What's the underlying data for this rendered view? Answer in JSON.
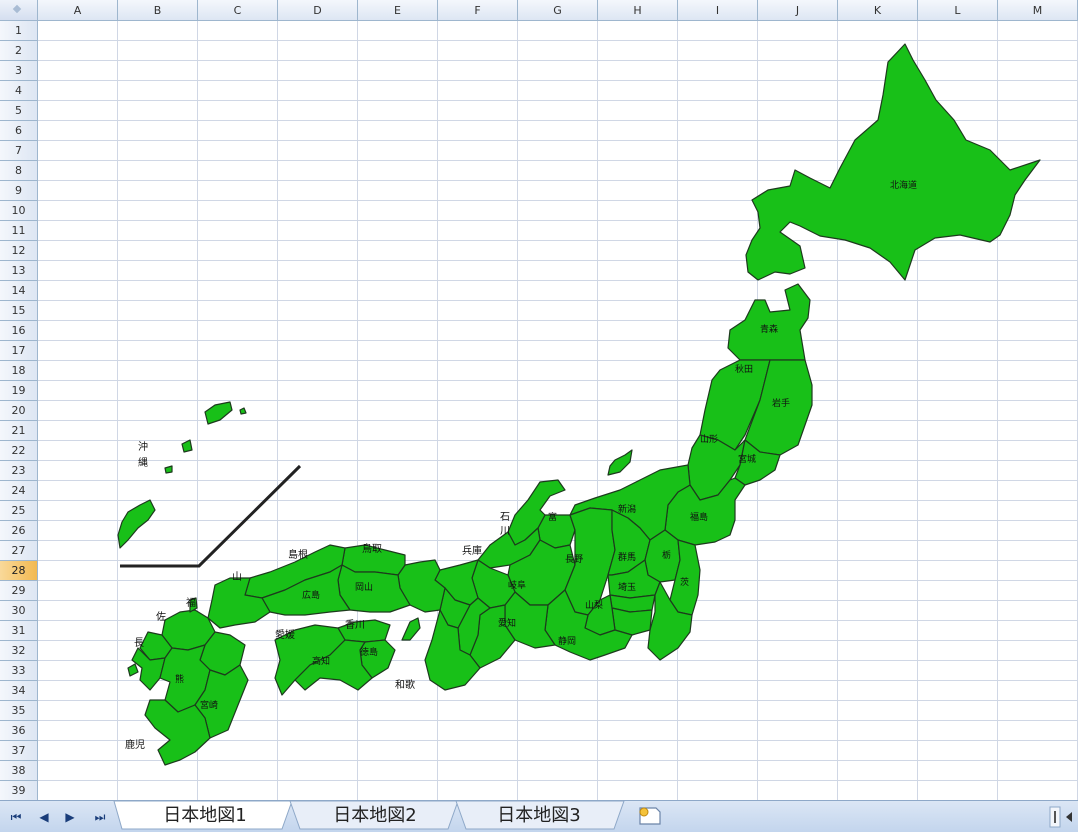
{
  "sheet": {
    "columns": [
      "A",
      "B",
      "C",
      "D",
      "E",
      "F",
      "G",
      "H",
      "I",
      "J",
      "K",
      "L",
      "M"
    ],
    "rows": [
      "1",
      "2",
      "3",
      "4",
      "5",
      "6",
      "7",
      "8",
      "9",
      "10",
      "11",
      "12",
      "13",
      "14",
      "15",
      "16",
      "17",
      "18",
      "19",
      "20",
      "21",
      "22",
      "23",
      "24",
      "25",
      "26",
      "27",
      "28",
      "29",
      "30",
      "31",
      "32",
      "33",
      "34",
      "35",
      "36",
      "37",
      "38",
      "39"
    ],
    "active_row": "28"
  },
  "map": {
    "labels": {
      "hokkaido": "北海道",
      "aomori": "青森",
      "akita": "秋田",
      "iwate": "岩手",
      "yamagata": "山形",
      "miyagi": "宮城",
      "fukushima": "福島",
      "niigata": "新潟",
      "ishikawa_1": "石",
      "ishikawa_2": "川",
      "toyama": "富",
      "tottori": "鳥取",
      "shimane": "島根",
      "hyogo": "兵庫",
      "yamaguchi": "山",
      "hiroshima": "広島",
      "okayama": "岡山",
      "gifu": "岐阜",
      "nagano": "長野",
      "gunma": "群馬",
      "tochigi": "栃",
      "ibaraki": "茨",
      "saitama": "埼玉",
      "yamanashi": "山梨",
      "shizuoka": "静岡",
      "aichi": "愛知",
      "ehime": "愛媛",
      "kagawa": "香川",
      "kochi": "高知",
      "tokushima": "徳島",
      "wakayama": "和歌",
      "fukuoka": "福",
      "saga": "佐",
      "nagasaki": "長",
      "kumamoto": "熊",
      "miyazaki": "宮崎",
      "kagoshima": "鹿児",
      "okinawa_1": "沖",
      "okinawa_2": "縄"
    }
  },
  "tabbar": {
    "nav": {
      "first": "⏮",
      "prev": "◀",
      "next": "▶",
      "last": "⏭"
    },
    "tabs": [
      "日本地図1",
      "日本地図2",
      "日本地図3"
    ],
    "active_tab": 0,
    "new_sheet_icon": "new-sheet-icon"
  }
}
